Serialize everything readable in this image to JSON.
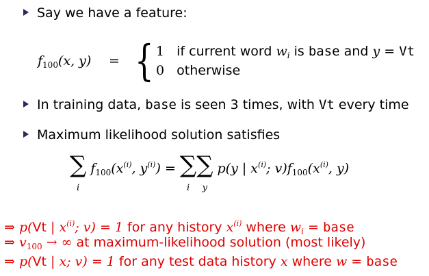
{
  "bullets": {
    "b1": "Say we have a feature:",
    "b2_pre": "In training data, ",
    "b2_tt1": "base",
    "b2_mid": " is seen 3 times, with ",
    "b2_tt2": "Vt",
    "b2_post": " every time",
    "b3": "Maximum likelihood solution satisfies"
  },
  "feature_def": {
    "lhs_f": "f",
    "lhs_sub": "100",
    "lhs_args": "(x, y)",
    "eq": "=",
    "case1_val": "1",
    "case1_text_a": "if current word ",
    "case1_w": "w",
    "case1_wsub": "i",
    "case1_text_b": " is ",
    "case1_tt": "base",
    "case1_text_c": " and ",
    "case1_y": "y",
    "case1_eq": " = ",
    "case1_tt2": "Vt",
    "case2_val": "0",
    "case2_text": "otherwise"
  },
  "equation": {
    "lhs_sum_idx": "i",
    "lhs_f": "f",
    "lhs_sub": "100",
    "lhs_args_a": "(x",
    "lhs_sup1": "(i)",
    "lhs_args_b": ", y",
    "lhs_sup2": "(i)",
    "lhs_args_c": ")",
    "eq": "=",
    "rhs_sum_idx1": "i",
    "rhs_sum_idx2": "y",
    "rhs_p": "p(y | x",
    "rhs_sup1": "(i)",
    "rhs_p2": "; v)f",
    "rhs_sub": "100",
    "rhs_args_a": "(x",
    "rhs_sup2": "(i)",
    "rhs_args_b": ", y)"
  },
  "implications": {
    "l1_arrow": "⇒",
    "l1_a": "p(",
    "l1_tt": "Vt",
    "l1_b": " | x",
    "l1_sup": "(i)",
    "l1_c": "; v) = 1",
    "l1_text": " for any history ",
    "l1_x": "x",
    "l1_xsup": "(i)",
    "l1_text2": " where ",
    "l1_w": "w",
    "l1_wsub": "i",
    "l1_eq": " = ",
    "l1_tt2": "base",
    "l2_arrow": "⇒",
    "l2_v": "v",
    "l2_vsub": "100",
    "l2_math": " → ∞",
    "l2_text": " at maximum-likelihood solution (most likely)",
    "l3_arrow": "⇒",
    "l3_a": "p(",
    "l3_tt": "Vt",
    "l3_b": " | x; v) = 1",
    "l3_text": " for any test data history ",
    "l3_x": "x",
    "l3_text2": " where ",
    "l3_w": "w",
    "l3_eq": " = ",
    "l3_tt2": "base"
  },
  "colors": {
    "bullet": "#2a2a5a",
    "implication": "#e00000"
  }
}
